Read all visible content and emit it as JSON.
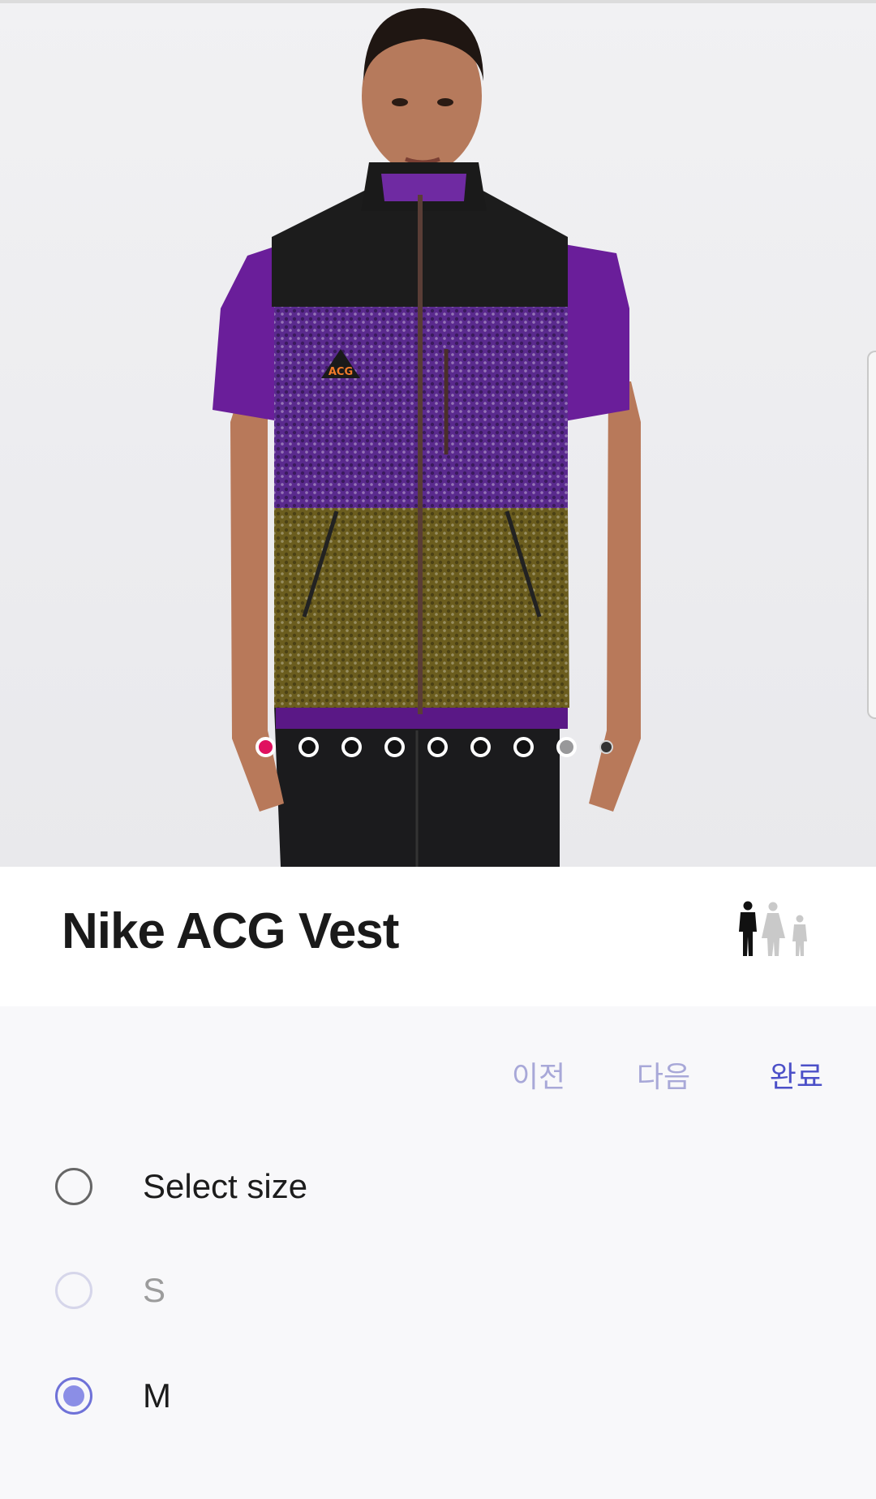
{
  "product": {
    "title": "Nike ACG Vest",
    "image_alt": "Model wearing Nike ACG fleece vest"
  },
  "carousel": {
    "total_dots": 9,
    "active_index": 0
  },
  "gender_icon": "male-female-child-icon",
  "picker": {
    "prev_label": "이전",
    "next_label": "다음",
    "done_label": "완료",
    "options": [
      {
        "label": "Select size",
        "state": "unchecked"
      },
      {
        "label": "S",
        "state": "disabled"
      },
      {
        "label": "M",
        "state": "checked"
      }
    ]
  },
  "colors": {
    "accent": "#4c50c8",
    "radio_checked": "#8b8ee6",
    "carousel_active": "#e0115f"
  }
}
